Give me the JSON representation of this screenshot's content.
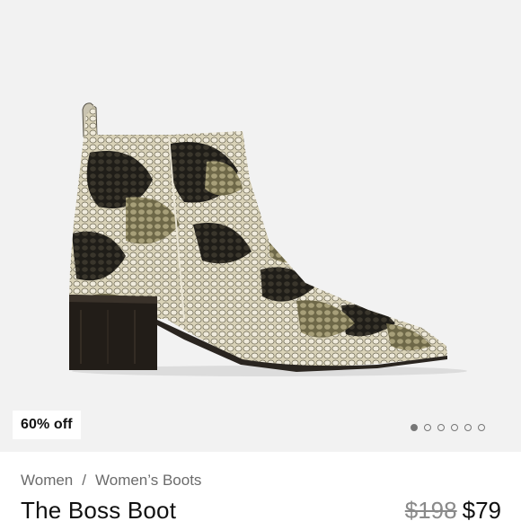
{
  "badge": {
    "label": "60% off"
  },
  "carousel": {
    "total": 6,
    "active_index": 0
  },
  "breadcrumb": {
    "items": [
      "Women",
      "Women’s Boots"
    ],
    "separator": "/"
  },
  "product": {
    "title": "The Boss Boot",
    "original_price": "$198",
    "sale_price": "$79"
  },
  "colors": {
    "hero_bg": "#f2f2f2",
    "text": "#111111",
    "muted": "#6b6b6b"
  }
}
